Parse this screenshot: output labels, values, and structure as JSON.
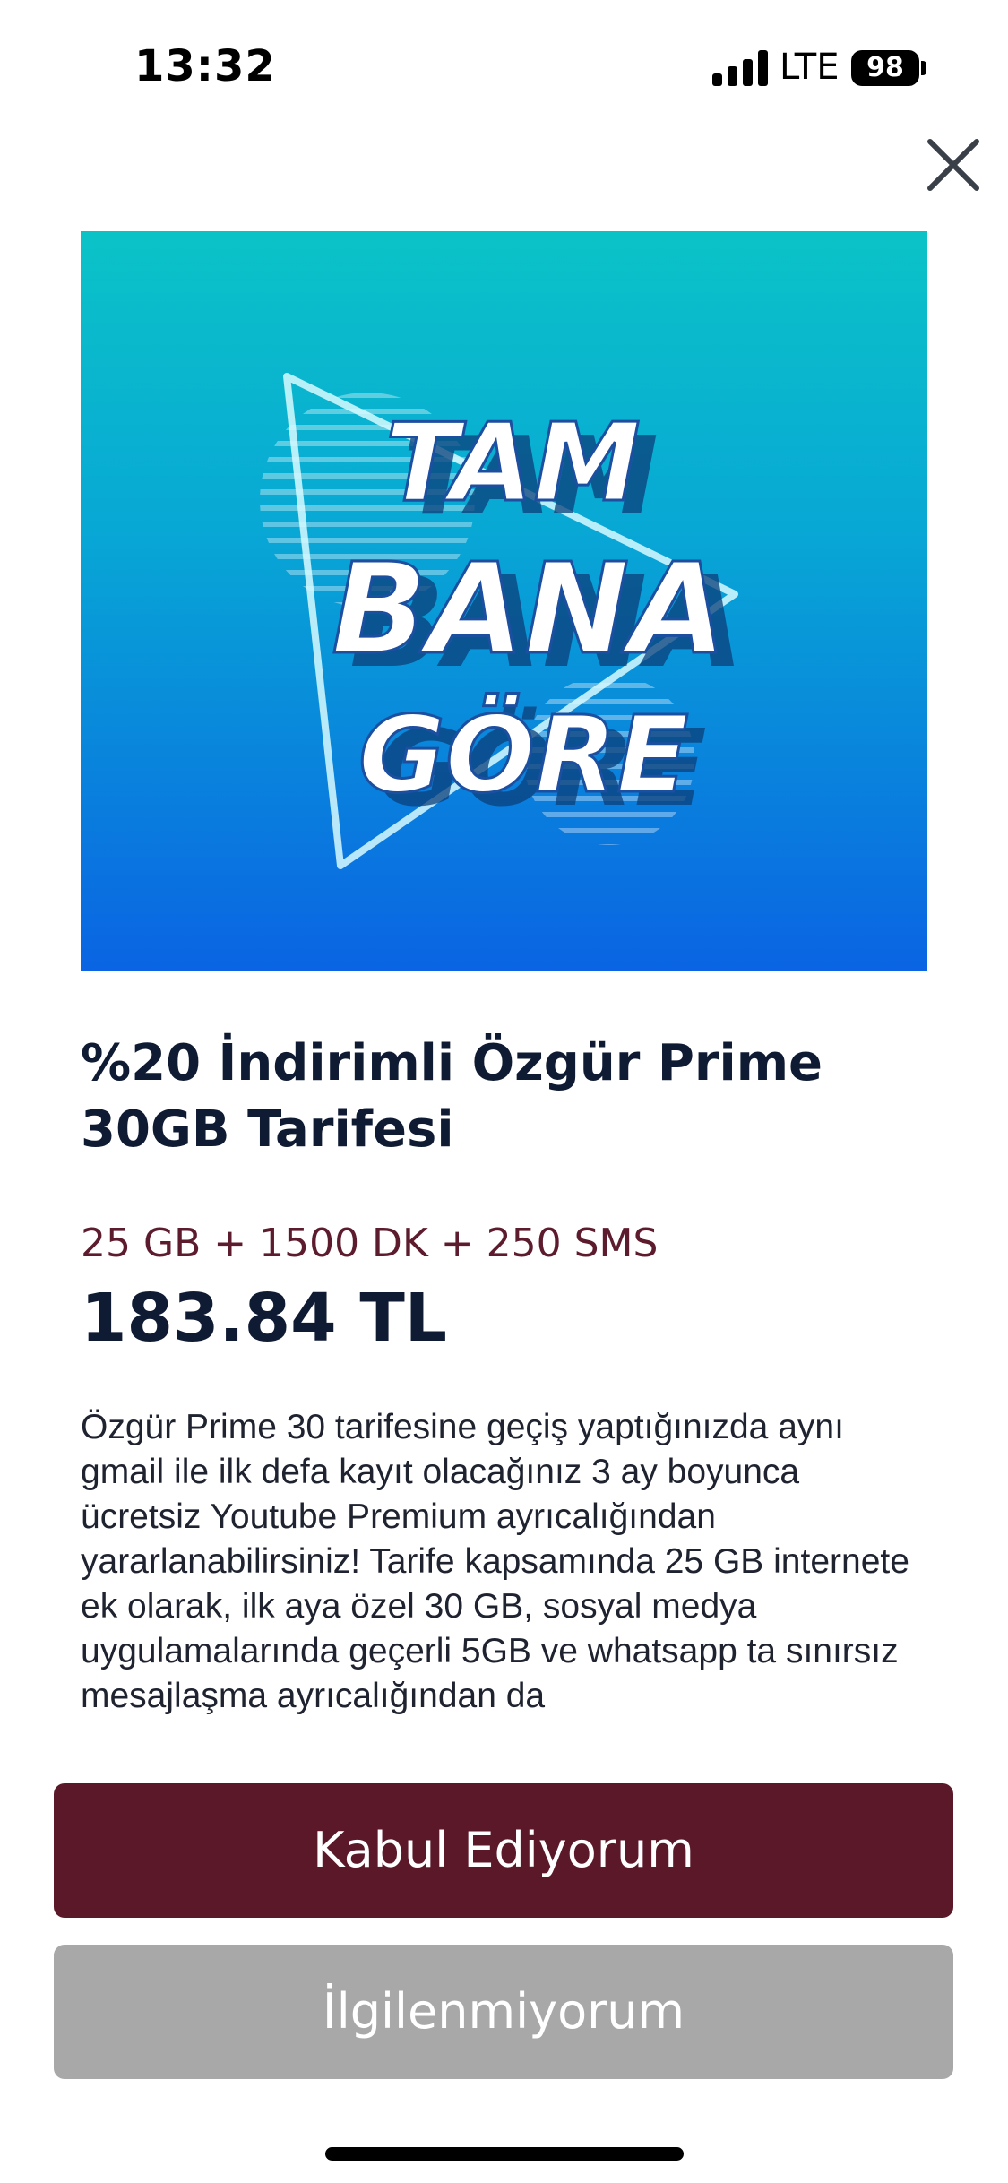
{
  "status_bar": {
    "time": "13:32",
    "network": "LTE",
    "battery": "98"
  },
  "banner": {
    "line1": "TAM",
    "line2": "BANA",
    "line3": "GÖRE",
    "colors": {
      "top": "#0bc3c7",
      "bottom": "#0a64e3"
    }
  },
  "offer": {
    "title": "%20 İndirimli Özgür Prime 30GB Tarifesi",
    "features": "25 GB + 1500 DK + 250 SMS",
    "price": "183.84 TL",
    "description": "Özgür Prime 30 tarifesine geçiş yaptığınızda aynı gmail ile ilk defa kayıt olacağınız 3 ay boyunca ücretsiz Youtube Premium ayrıcalığından yararlanabilirsiniz! Tarife kapsamında 25 GB internete ek olarak, ilk aya özel 30 GB,  sosyal medya uygulamalarında geçerli 5GB ve whatsapp ta sınırsız mesajlaşma ayrıcalığından da"
  },
  "actions": {
    "accept_label": "Kabul Ediyorum",
    "decline_label": "İlgilenmiyorum"
  },
  "colors": {
    "accent": "#5b1829",
    "disabled": "#a8a8a8",
    "title": "#0f1b33"
  },
  "icons": {
    "close": "close-icon",
    "signal": "signal-icon",
    "battery": "battery-icon"
  }
}
